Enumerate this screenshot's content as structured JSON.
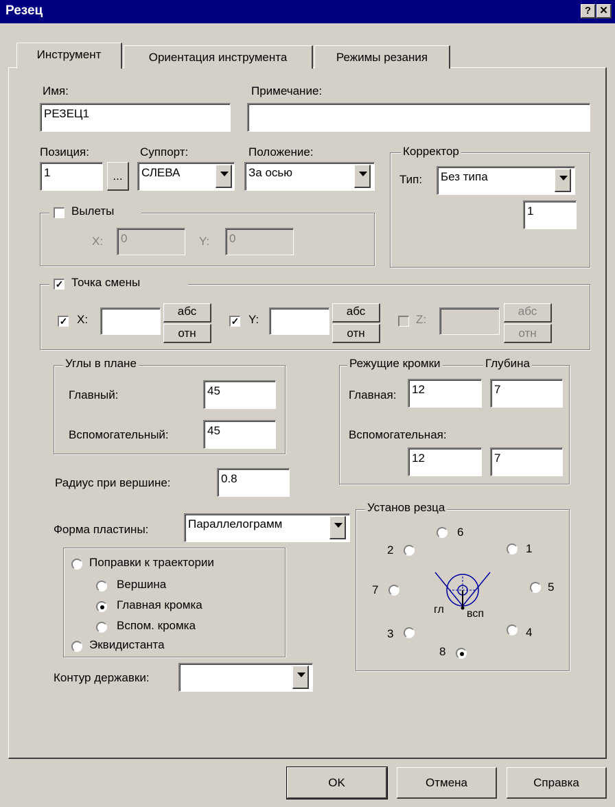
{
  "window": {
    "title": "Резец",
    "help_btn": "?",
    "close_btn": "✕"
  },
  "tabs": [
    "Инструмент",
    "Ориентация инструмента",
    "Режимы резания"
  ],
  "name": {
    "label": "Имя:",
    "value": "РЕЗЕЦ1"
  },
  "note": {
    "label": "Примечание:",
    "value": ""
  },
  "position": {
    "label": "Позиция:",
    "value": "1",
    "browse": "..."
  },
  "support": {
    "label": "Суппорт:",
    "value": "СЛЕВА"
  },
  "placement": {
    "label": "Положение:",
    "value": "За осью"
  },
  "corrector": {
    "title": "Корректор",
    "type_label": "Тип:",
    "type_value": "Без типа",
    "number": "1"
  },
  "overhang": {
    "title": "Вылеты",
    "checked": false,
    "x_label": "X:",
    "x_value": "0",
    "y_label": "Y:",
    "y_value": "0"
  },
  "change_point": {
    "title": "Точка смены",
    "checked": true,
    "x_label": "X:",
    "x_checked": true,
    "x_value": "",
    "y_label": "Y:",
    "y_checked": true,
    "y_value": "",
    "z_label": "Z:",
    "z_checked": false,
    "z_value": "",
    "abs": "абс",
    "rel": "отн"
  },
  "plan_angles": {
    "title": "Углы в плане",
    "main_label": "Главный:",
    "main_value": "45",
    "aux_label": "Вспомогательный:",
    "aux_value": "45"
  },
  "cutting_edges": {
    "title": "Режущие кромки",
    "depth_title": "Глубина",
    "main_label": "Главная:",
    "main_value": "12",
    "main_depth": "7",
    "aux_label": "Вспомогательная:",
    "aux_value": "12",
    "aux_depth": "7"
  },
  "tip_radius": {
    "label": "Радиус при вершине:",
    "value": "0.8"
  },
  "insert_shape": {
    "label": "Форма пластины:",
    "value": "Параллелограмм"
  },
  "corrections": {
    "path_label": "Поправки к траектории",
    "vertex_label": "Вершина",
    "main_edge_label": "Главная кромка",
    "aux_edge_label": "Вспом. кромка",
    "equidistant_label": "Эквидистанта",
    "selected": "Главная кромка"
  },
  "holder": {
    "label": "Контур державки:",
    "value": ""
  },
  "setup": {
    "title": "Установ резца",
    "positions": [
      "1",
      "2",
      "3",
      "4",
      "5",
      "6",
      "7",
      "8"
    ],
    "selected": "8",
    "gl": "гл",
    "vsp": "всп"
  },
  "buttons": {
    "ok": "OK",
    "cancel": "Отмена",
    "help": "Справка"
  },
  "colors": {
    "titlebar": "#000080",
    "face": "#d4d0c8",
    "diagram": "#0000a0"
  }
}
